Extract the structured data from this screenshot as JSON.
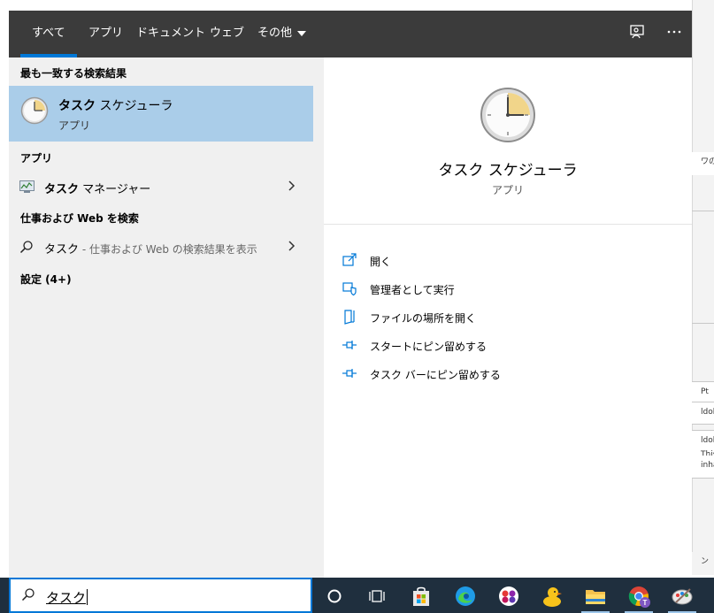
{
  "tabs": [
    {
      "label": "すべて"
    },
    {
      "label": "アプリ"
    },
    {
      "label": "ドキュメント"
    },
    {
      "label": "ウェブ"
    },
    {
      "label": "その他"
    }
  ],
  "left": {
    "best_match_header": "最も一致する検索結果",
    "best_match": {
      "title_bold": "タスク",
      "title_rest": " スケジューラ",
      "subtitle": "アプリ"
    },
    "apps_header": "アプリ",
    "app_item": {
      "bold": "タスク",
      "rest": " マネージャー"
    },
    "web_header": "仕事および Web を検索",
    "web_item": {
      "bold": "タスク",
      "rest": " - 仕事および Web の検索結果を表示"
    },
    "settings_header": "設定 (4+)"
  },
  "right": {
    "title": "タスク スケジューラ",
    "subtitle": "アプリ",
    "actions": [
      {
        "label": "開く",
        "icon": "open-icon"
      },
      {
        "label": "管理者として実行",
        "icon": "run-as-admin-icon"
      },
      {
        "label": "ファイルの場所を開く",
        "icon": "file-location-icon"
      },
      {
        "label": "スタートにピン留めする",
        "icon": "pin-icon"
      },
      {
        "label": "タスク バーにピン留めする",
        "icon": "pin-icon"
      }
    ]
  },
  "search": {
    "value": "タスク"
  },
  "background_fragments": [
    "ワの",
    "Pt",
    "ldob",
    "ldob",
    "This",
    "inha",
    "ン"
  ],
  "colors": {
    "accent": "#0078d7",
    "selected": "#aacde9",
    "tabbar": "#3b3b3b",
    "taskbar": "#1f2f3e"
  }
}
